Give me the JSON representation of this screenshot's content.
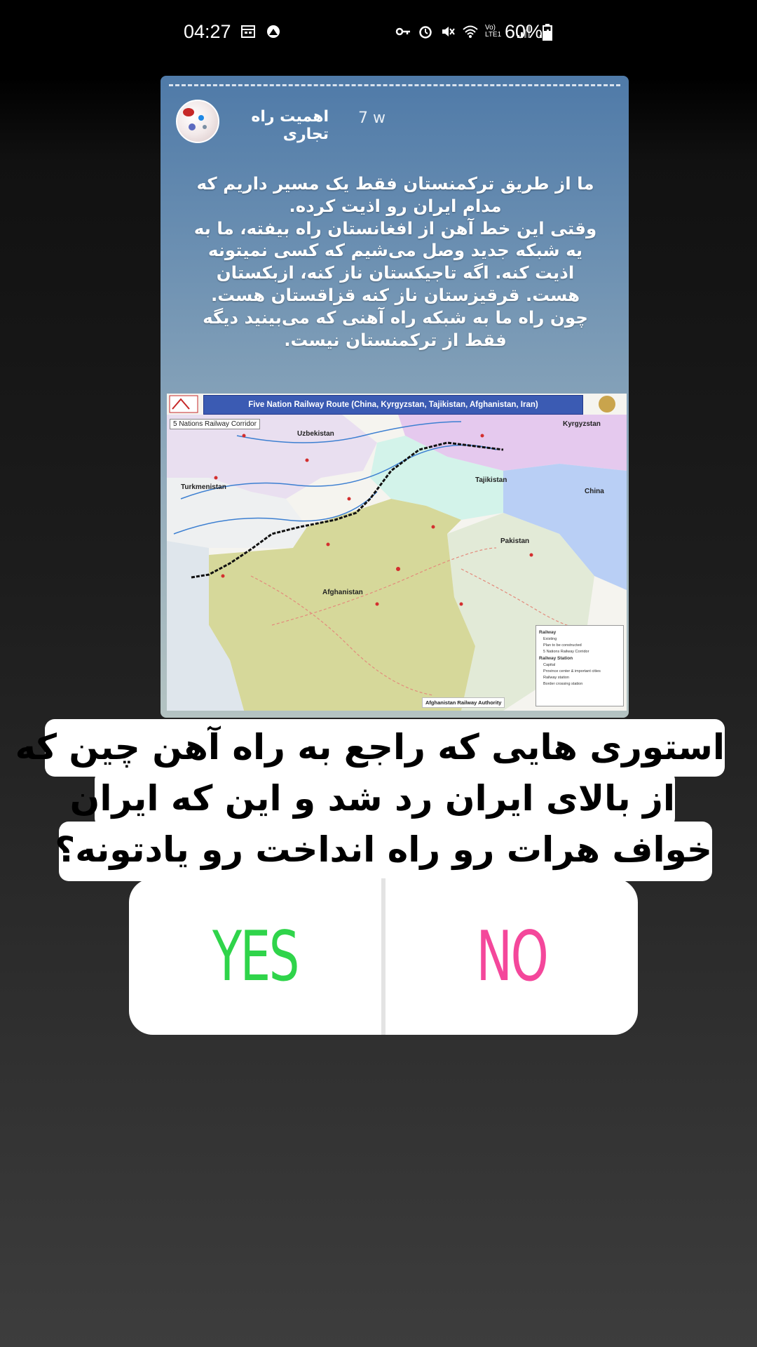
{
  "status_bar": {
    "time": "04:27",
    "battery": "60%",
    "left_icons": [
      "calendar-icon",
      "app-notification-icon"
    ],
    "right_icons": [
      "key-icon",
      "alarm-icon",
      "mute-icon",
      "wifi-icon",
      "volte-icon",
      "signal-icon",
      "signal-icon",
      "battery-icon"
    ],
    "volte_label": "Vo) LTE1"
  },
  "post": {
    "username": "اهمیت راه تجاری",
    "age": "7 w",
    "text_lines": [
      "ما از طریق ترکمنستان فقط یک مسیر داریم که",
      "مدام ایران رو اذیت کرده.",
      "وقتی این خط آهن از افغانستان راه بیفته، ما به",
      "یه شبکه جدید وصل می‌شیم که کسی نمیتونه",
      "اذیت کنه. اگه تاجیکستان ناز کنه، ازبکستان",
      "هست. قرقیزستان ناز کنه قزاقستان هست.",
      "چون راه ما به شبکه راه آهنی که می‌بینید دیگه",
      "فقط از ترکمنستان نیست."
    ],
    "map": {
      "title": "Five Nation Railway Route (China, Kyrgyzstan, Tajikistan, Afghanistan, Iran)",
      "corridor_label": "5 Nations Railway Corridor",
      "countries": [
        "Uzbekistan",
        "Kyrgyzstan",
        "Turkmenistan",
        "Tajikistan",
        "China",
        "Pakistan",
        "Afghanistan"
      ],
      "legend_title_railway": "Railway",
      "legend_railway": [
        "Existing",
        "Plan to be constructed",
        "5 Nations Railway Corridor"
      ],
      "legend_title_station": "Railway Station",
      "legend_station": [
        "Capital",
        "Province center & important cities",
        "Railway station",
        "Border crossing station"
      ],
      "authority": "Afghanistan Railway Authority"
    }
  },
  "question": {
    "lines": [
      "استوری هایی که راجع به راه آهن چین که",
      "از بالای ایران رد شد و این که ایران",
      "خواف هرات رو راه انداخت رو یادتونه؟"
    ]
  },
  "poll": {
    "yes_label": "YES",
    "no_label": "NO",
    "yes_color": "#2fd44a",
    "no_color": "#f4479b"
  }
}
